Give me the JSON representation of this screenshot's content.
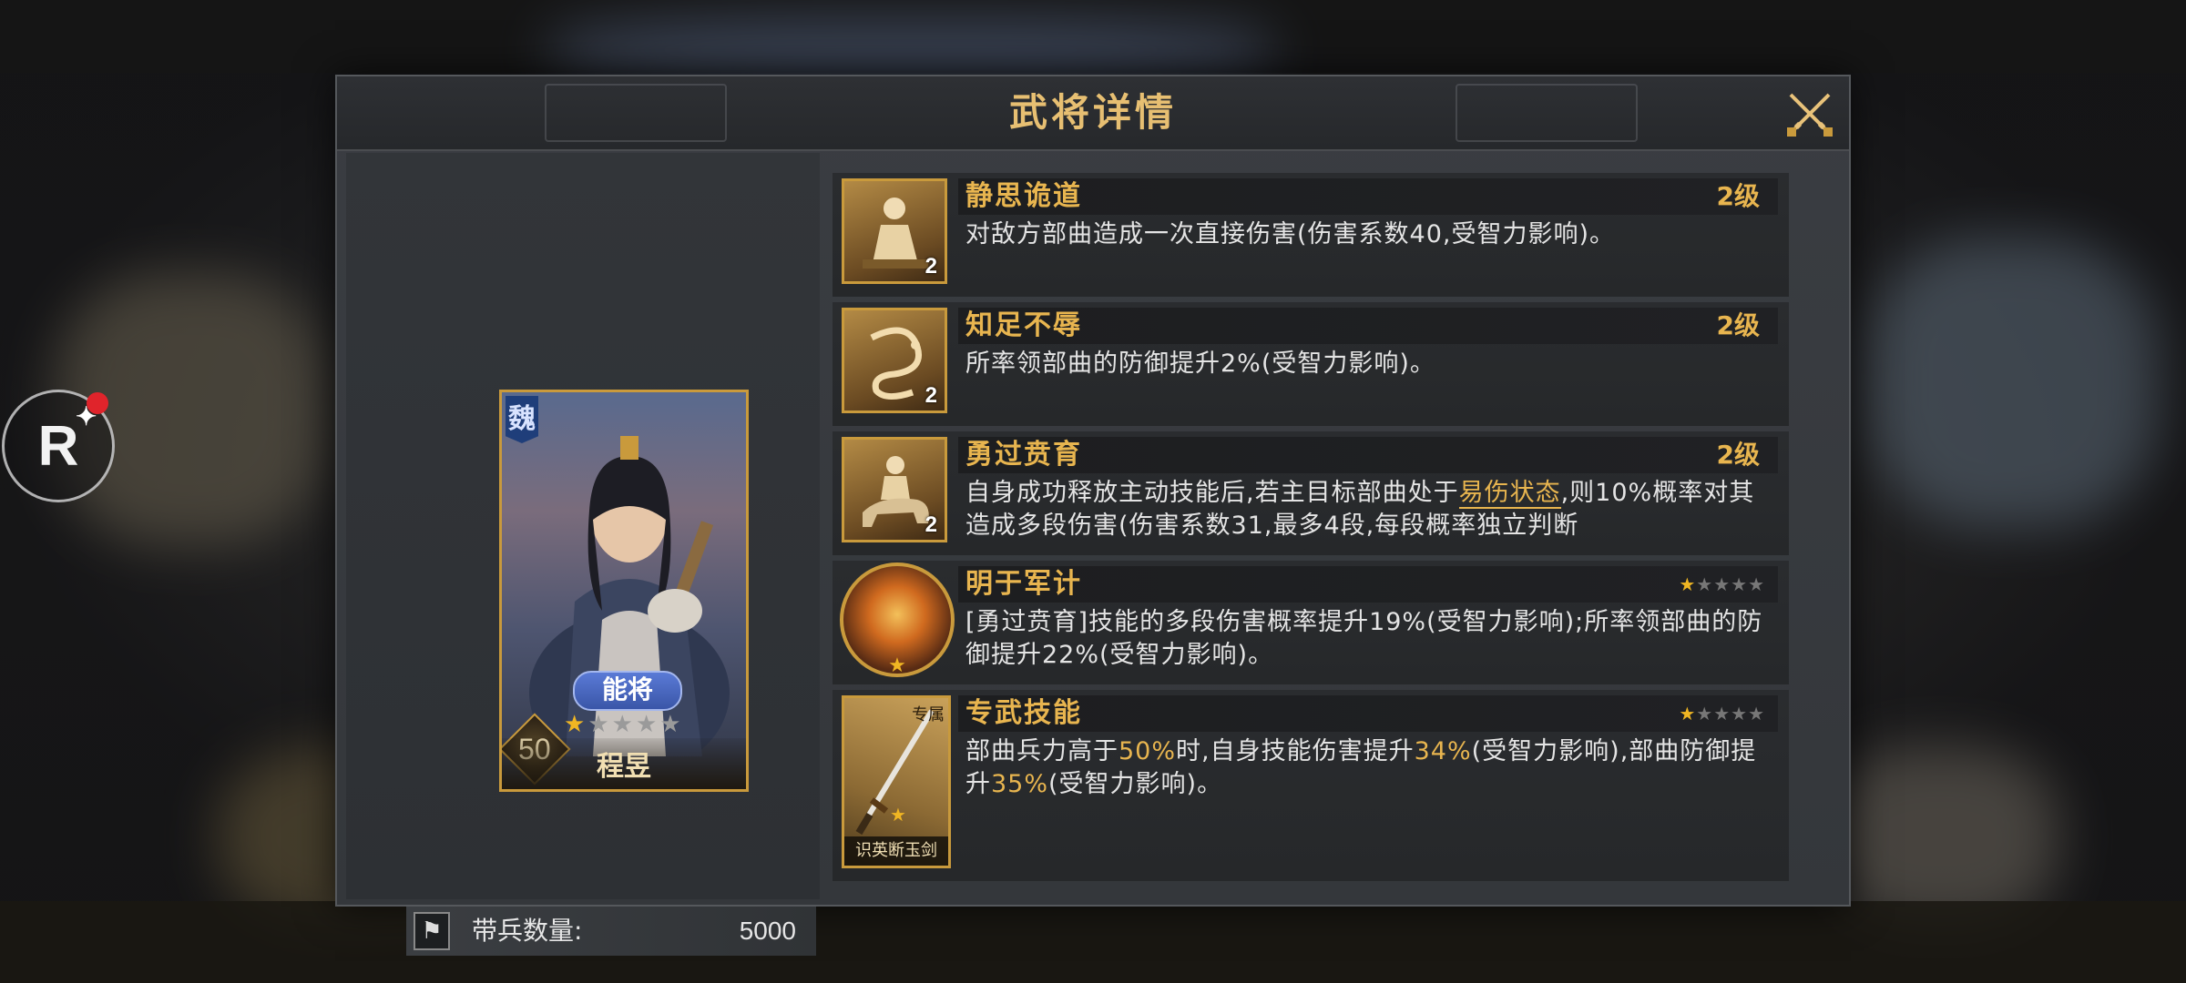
{
  "dialog": {
    "title": "武将详情",
    "close_icon": "crossed-swords-close-icon"
  },
  "hero": {
    "faction": "魏",
    "rank": "能将",
    "level": "50",
    "stars_filled": 1,
    "stars_total": 5,
    "name": "程昱"
  },
  "troops": {
    "label": "带兵数量:",
    "value": "5000"
  },
  "skills": [
    {
      "name": "静思诡道",
      "grade": "2级",
      "icon_level": "2",
      "desc": "对敌方部曲造成一次直接伤害(伤害系数40,受智力影响)。"
    },
    {
      "name": "知足不辱",
      "grade": "2级",
      "icon_level": "2",
      "desc": "所率领部曲的防御提升2%(受智力影响)。"
    },
    {
      "name": "勇过贲育",
      "grade": "2级",
      "icon_level": "2",
      "desc_a": "自身成功释放主动技能后,若主目标部曲处于",
      "desc_keyword": "易伤状态",
      "desc_b": ",则10%概率对其造成多段伤害(伤害系数31,最多4段,每段概率独立判断"
    },
    {
      "name": "明于军计",
      "stars_filled": 1,
      "stars_total": 5,
      "desc": "[勇过贲育]技能的多段伤害概率提升19%(受智力影响);所率领部曲的防御提升22%(受智力影响)。"
    },
    {
      "name": "专武技能",
      "stars_filled": 1,
      "stars_total": 5,
      "weapon_tag": "专属",
      "weapon_name": "识英断玉剑",
      "desc_1": "部曲兵力高于",
      "val_1": "50%",
      "desc_2": "时,自身技能伤害提升",
      "val_2": "34%",
      "desc_3": "(受智力影响),部曲防御提升",
      "val_3": "35%",
      "desc_4": "(受智力影响)。"
    }
  ],
  "colors": {
    "gold": "#e8b54f",
    "panel": "#34373b",
    "frame": "#c99a3c"
  }
}
